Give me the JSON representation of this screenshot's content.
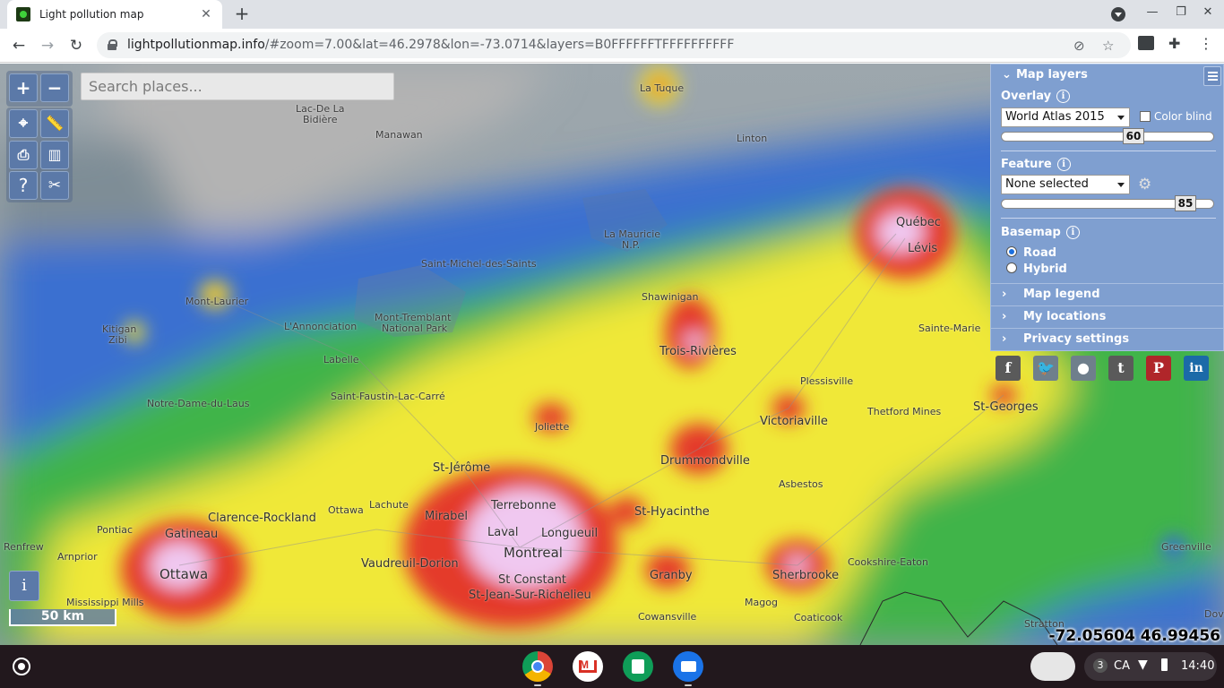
{
  "browser": {
    "tab_title": "Light pollution map",
    "url_host": "lightpollutionmap.info",
    "url_rest": "/#zoom=7.00&lat=46.2978&lon=-73.0714&layers=B0FFFFFFTFFFFFFFFFF",
    "new_tab": "+",
    "close": "✕"
  },
  "map": {
    "search_placeholder": "Search places...",
    "zoom_in": "+",
    "zoom_out": "−",
    "help": "?",
    "info": "i",
    "scale_label": "50 km",
    "coordinates": "-72.05604 46.99456",
    "places": [
      {
        "name": "La Tuque",
        "cls": ""
      },
      {
        "name": "Lac-De La",
        "cls": ""
      },
      {
        "name": "Bidière",
        "cls": ""
      },
      {
        "name": "Manawan",
        "cls": ""
      },
      {
        "name": "Linton",
        "cls": ""
      },
      {
        "name": "La Mauricie",
        "cls": ""
      },
      {
        "name": "N.P.",
        "cls": ""
      },
      {
        "name": "Saint-Michel-des-Saints",
        "cls": ""
      },
      {
        "name": "Mont-Laurier",
        "cls": ""
      },
      {
        "name": "Kitigan",
        "cls": ""
      },
      {
        "name": "Zibi",
        "cls": ""
      },
      {
        "name": "Mont-Tremblant",
        "cls": ""
      },
      {
        "name": "National Park",
        "cls": ""
      },
      {
        "name": "L'Annonciation",
        "cls": ""
      },
      {
        "name": "Labelle",
        "cls": ""
      },
      {
        "name": "Shawinigan",
        "cls": ""
      },
      {
        "name": "Trois-Rivières",
        "cls": "big"
      },
      {
        "name": "Québec",
        "cls": "big"
      },
      {
        "name": "Lévis",
        "cls": "big"
      },
      {
        "name": "Sainte-Marie",
        "cls": ""
      },
      {
        "name": "Plessisville",
        "cls": ""
      },
      {
        "name": "Victoriaville",
        "cls": "big"
      },
      {
        "name": "Thetford Mines",
        "cls": ""
      },
      {
        "name": "St-Georges",
        "cls": "big"
      },
      {
        "name": "Notre-Dame-du-Laus",
        "cls": ""
      },
      {
        "name": "Saint-Faustin-Lac-Carré",
        "cls": ""
      },
      {
        "name": "Joliette",
        "cls": ""
      },
      {
        "name": "Drummondville",
        "cls": "big"
      },
      {
        "name": "Asbestos",
        "cls": ""
      },
      {
        "name": "St-Jérôme",
        "cls": "big"
      },
      {
        "name": "Terrebonne",
        "cls": "big"
      },
      {
        "name": "Mirabel",
        "cls": "big"
      },
      {
        "name": "Laval",
        "cls": "big"
      },
      {
        "name": "Longueuil",
        "cls": "big"
      },
      {
        "name": "St-Hyacinthe",
        "cls": "big"
      },
      {
        "name": "Clarence-Rockland",
        "cls": "big"
      },
      {
        "name": "Lachute",
        "cls": ""
      },
      {
        "name": "Ottawa",
        "cls": ""
      },
      {
        "name": "Pontiac",
        "cls": ""
      },
      {
        "name": "Gatineau",
        "cls": "big"
      },
      {
        "name": "Renfrew",
        "cls": ""
      },
      {
        "name": "Arnprior",
        "cls": ""
      },
      {
        "name": "Ottawa",
        "cls": "huge"
      },
      {
        "name": "Vaudreuil-Dorion",
        "cls": "big"
      },
      {
        "name": "Montreal",
        "cls": "huge"
      },
      {
        "name": "St Constant",
        "cls": "big"
      },
      {
        "name": "St-Jean-Sur-Richelieu",
        "cls": "big"
      },
      {
        "name": "Granby",
        "cls": "big"
      },
      {
        "name": "Sherbrooke",
        "cls": "big"
      },
      {
        "name": "Cookshire-Eaton",
        "cls": ""
      },
      {
        "name": "Greenville",
        "cls": ""
      },
      {
        "name": "Mississippi Mills",
        "cls": ""
      },
      {
        "name": "Cowansville",
        "cls": ""
      },
      {
        "name": "Magog",
        "cls": ""
      },
      {
        "name": "Coaticook",
        "cls": ""
      },
      {
        "name": "Stratton",
        "cls": ""
      },
      {
        "name": "Dov",
        "cls": ""
      }
    ]
  },
  "layers_panel": {
    "title": "Map layers",
    "overlay_label": "Overlay",
    "overlay_value": "World Atlas 2015",
    "color_blind_label": "Color blind",
    "overlay_opacity": "60",
    "feature_label": "Feature",
    "feature_value": "None selected",
    "feature_opacity": "85",
    "basemap_label": "Basemap",
    "basemap_options": [
      "Road",
      "Hybrid"
    ],
    "basemap_selected": "Road",
    "map_legend": "Map legend",
    "my_locations": "My locations",
    "privacy_settings": "Privacy settings",
    "info_glyph": "i"
  },
  "social": [
    {
      "name": "facebook",
      "glyph": "f",
      "color": "#5a5a5a"
    },
    {
      "name": "twitter",
      "glyph": "t",
      "color": "#6f7f8c"
    },
    {
      "name": "reddit",
      "glyph": "r",
      "color": "#6f7f8c"
    },
    {
      "name": "tumblr",
      "glyph": "t",
      "color": "#5a5a5a"
    },
    {
      "name": "pinterest",
      "glyph": "P",
      "color": "#b0262a"
    },
    {
      "name": "linkedin",
      "glyph": "in",
      "color": "#1b6aa8"
    }
  ],
  "shelf": {
    "notification_count": "3",
    "locale": "CA",
    "time": "14:40"
  }
}
